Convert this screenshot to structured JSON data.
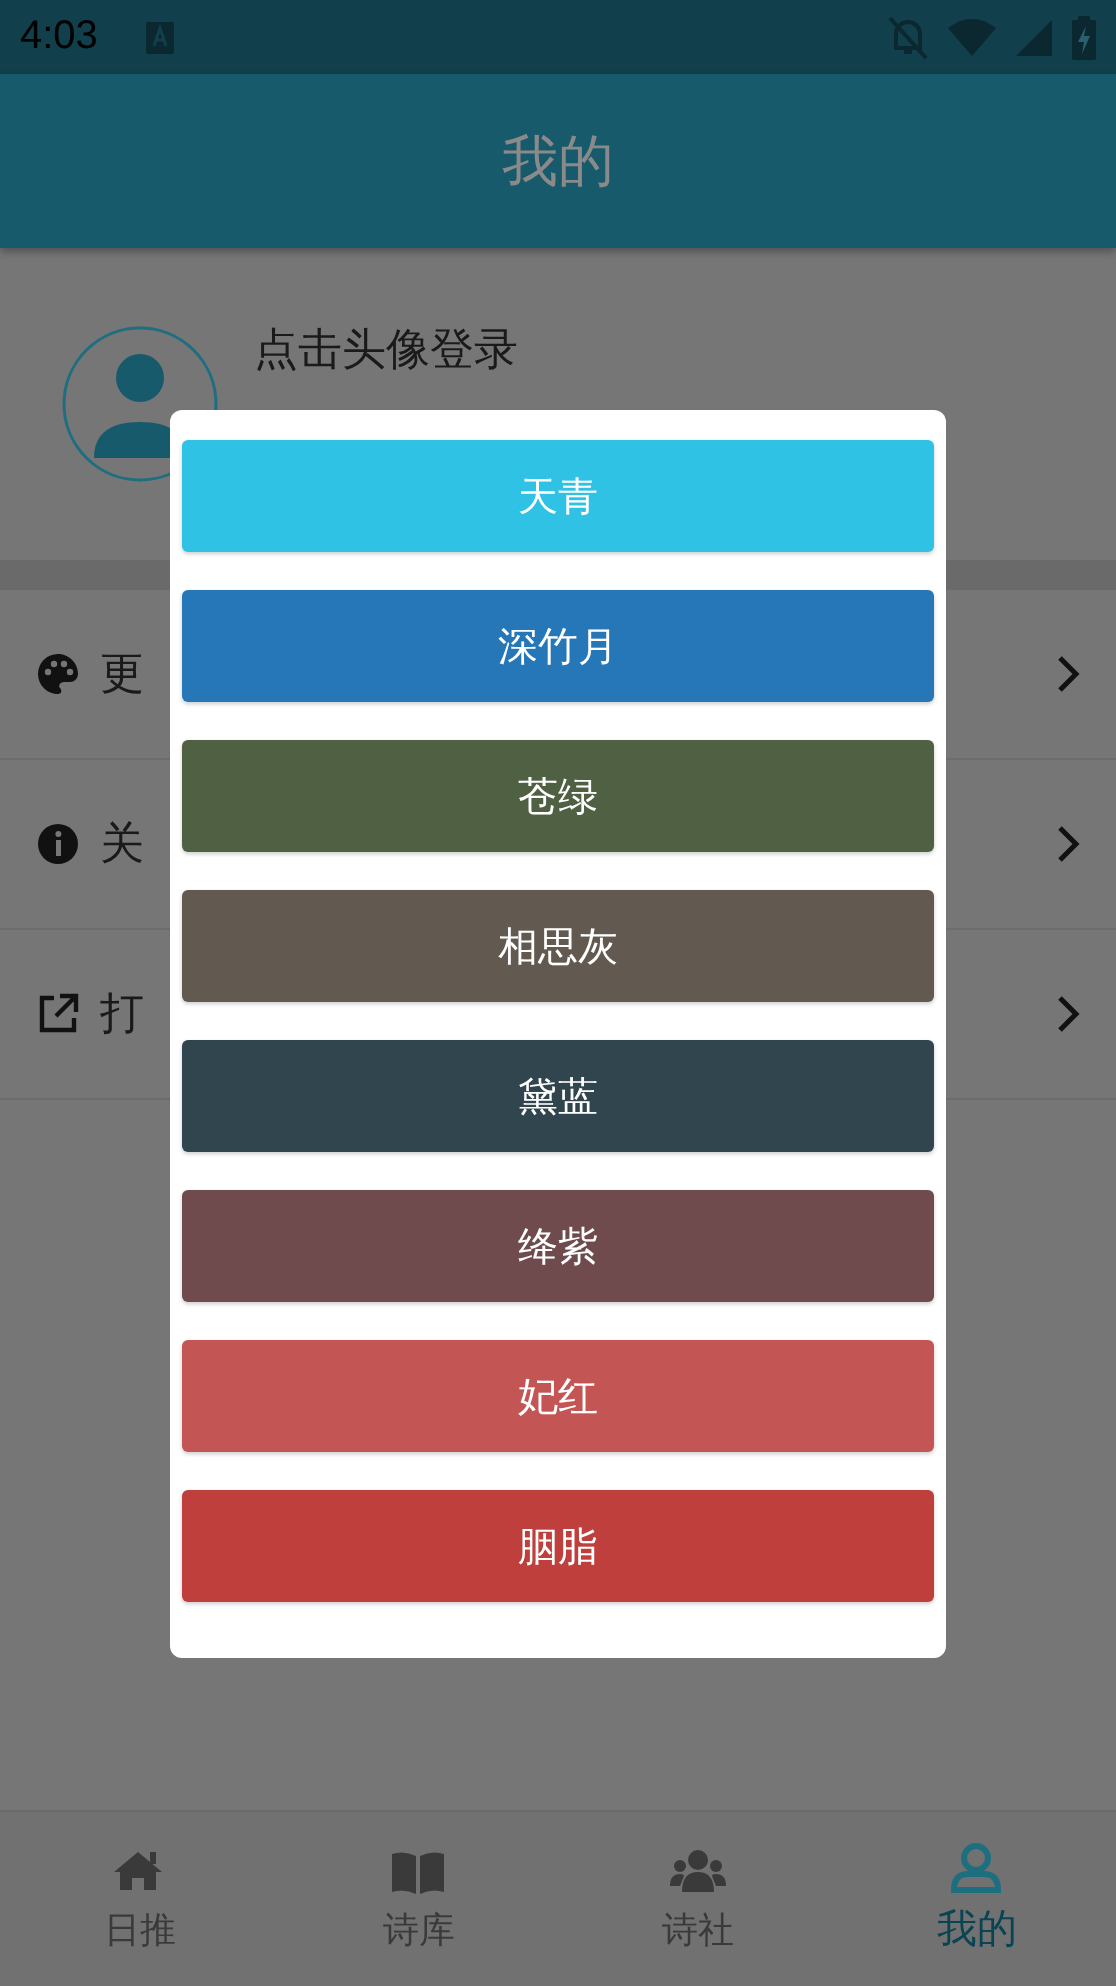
{
  "status_bar": {
    "time": "4:03"
  },
  "header": {
    "title": "我的"
  },
  "profile": {
    "prompt": "点击头像登录"
  },
  "menu": [
    {
      "kind": "palette",
      "label": "更"
    },
    {
      "kind": "info",
      "label": "关"
    },
    {
      "kind": "external",
      "label": "打"
    }
  ],
  "dialog": {
    "options": [
      {
        "label": "天青",
        "color": "#2fc2e5"
      },
      {
        "label": "深竹月",
        "color": "#2577b8"
      },
      {
        "label": "苍绿",
        "color": "#4f6043"
      },
      {
        "label": "相思灰",
        "color": "#625a50"
      },
      {
        "label": "黛蓝",
        "color": "#30454d"
      },
      {
        "label": "绛紫",
        "color": "#6f4b4e"
      },
      {
        "label": "妃红",
        "color": "#c35654"
      },
      {
        "label": "胭脂",
        "color": "#bf3f3d"
      }
    ]
  },
  "bottom_nav": [
    {
      "kind": "home",
      "label": "日推",
      "selected": false
    },
    {
      "kind": "book",
      "label": "诗库",
      "selected": false
    },
    {
      "kind": "users",
      "label": "诗社",
      "selected": false
    },
    {
      "kind": "user",
      "label": "我的",
      "selected": true
    }
  ]
}
